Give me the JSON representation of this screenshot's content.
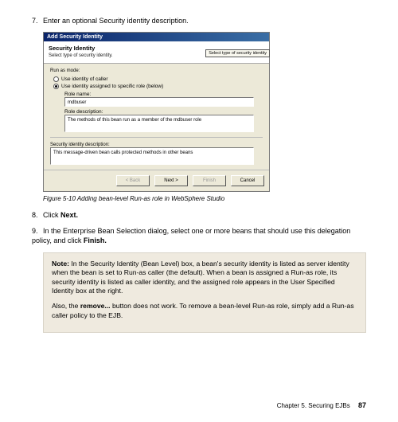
{
  "steps": {
    "s7": {
      "num": "7.",
      "text": "Enter an optional Security identity description."
    },
    "s8": {
      "num": "8.",
      "prefix": "Click ",
      "bold": "Next."
    },
    "s9": {
      "num": "9.",
      "prefix": "In the Enterprise Bean Selection dialog, select one or more beans that should use this delegation policy, and click ",
      "bold": "Finish."
    }
  },
  "dialog": {
    "title": "Add Security Identity",
    "head_title": "Security Identity",
    "head_sub": "Select type of security identity.",
    "callout": "Select type of security identity",
    "group_label": "Run as mode:",
    "radio1": "Use identity of caller",
    "radio2": "Use identity assigned to specific role (below)",
    "role_name_label": "Role name:",
    "role_name_value": "mdbuser",
    "role_desc_label": "Role description:",
    "role_desc_value": "The methods of this bean run as a member of the mdbuser role",
    "sec_desc_label": "Security identity description:",
    "sec_desc_value": "This message-driven bean calls protected methods in other beans",
    "btn_back": "< Back",
    "btn_next": "Next >",
    "btn_finish": "Finish",
    "btn_cancel": "Cancel"
  },
  "caption": "Figure 5-10   Adding bean-level Run-as role in WebSphere Studio",
  "note": {
    "p1_label": "Note:",
    "p1_text": " In the Security Identity (Bean Level) box, a bean's security identity is listed as server identity when the bean is set to Run-as caller (the default). When a bean is assigned a Run-as role, its security identity is listed as caller identity, and the assigned role appears in the User Specified Identity box at the right.",
    "p2_prefix": "Also, the ",
    "p2_bold": "remove...",
    "p2_suffix": " button does not work. To remove a bean-level Run-as role, simply add a Run-as caller policy to the EJB."
  },
  "footer": {
    "chapter": "Chapter 5. Securing EJBs",
    "page": "87"
  }
}
